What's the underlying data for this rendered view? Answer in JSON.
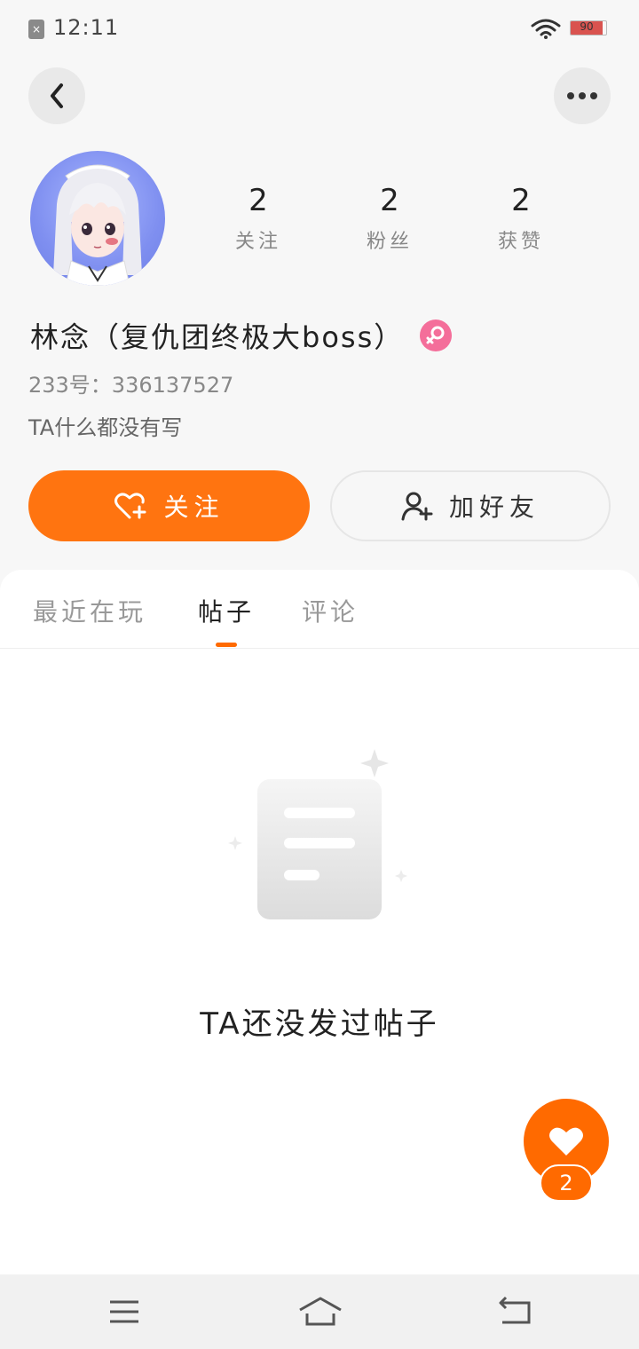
{
  "status_bar": {
    "time": "12:11",
    "battery": "90",
    "battery_level": 0.9,
    "sim_icon": "sim-error-icon",
    "wifi_icon": "wifi-icon"
  },
  "header": {
    "back_icon": "chevron-left-icon",
    "more_icon": "more-dots-icon"
  },
  "profile": {
    "stats": [
      {
        "value": "2",
        "label": "关注"
      },
      {
        "value": "2",
        "label": "粉丝"
      },
      {
        "value": "2",
        "label": "获赞"
      }
    ],
    "name": "林念（复仇团终极大boss）",
    "gender_icon": "female-icon",
    "user_id": "233号：336137527",
    "bio": "TA什么都没有写"
  },
  "actions": {
    "follow_label": "关注",
    "add_friend_label": "加好友"
  },
  "tabs": [
    {
      "label": "最近在玩",
      "active": false
    },
    {
      "label": "帖子",
      "active": true
    },
    {
      "label": "评论",
      "active": false
    }
  ],
  "empty_state": {
    "text": "TA还没发过帖子"
  },
  "like_fab": {
    "count": "2",
    "icon": "heart-icon"
  },
  "colors": {
    "accent": "#ff7410",
    "gender_badge": "#f46e9a"
  }
}
